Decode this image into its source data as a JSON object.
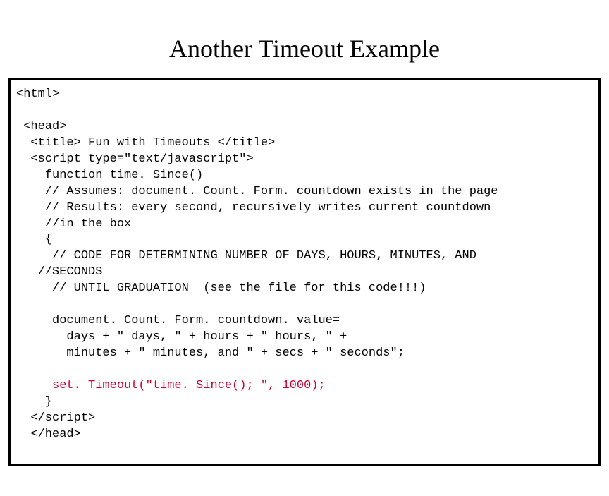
{
  "title": "Another Timeout Example",
  "code": {
    "l01": "<html>",
    "l02": "",
    "l03": " <head>",
    "l04": "  <title> Fun with Timeouts </title>",
    "l05": "  <script type=\"text/javascript\">",
    "l06": "    function time. Since()",
    "l07": "    // Assumes: document. Count. Form. countdown exists in the page",
    "l08": "    // Results: every second, recursively writes current countdown",
    "l09": "    //in the box",
    "l10": "    {",
    "l11": "     // CODE FOR DETERMINING NUMBER OF DAYS, HOURS, MINUTES, AND",
    "l12": "   //SECONDS",
    "l13": "     // UNTIL GRADUATION  (see the file for this code!!!)",
    "l14": "",
    "l15": "     document. Count. Form. countdown. value=",
    "l16": "       days + \" days, \" + hours + \" hours, \" +",
    "l17": "       minutes + \" minutes, and \" + secs + \" seconds\";",
    "l18": "",
    "l19": "     set. Timeout(\"time. Since(); \", 1000);",
    "l20": "    }",
    "l21": "  </script>",
    "l22": "  </head>"
  }
}
